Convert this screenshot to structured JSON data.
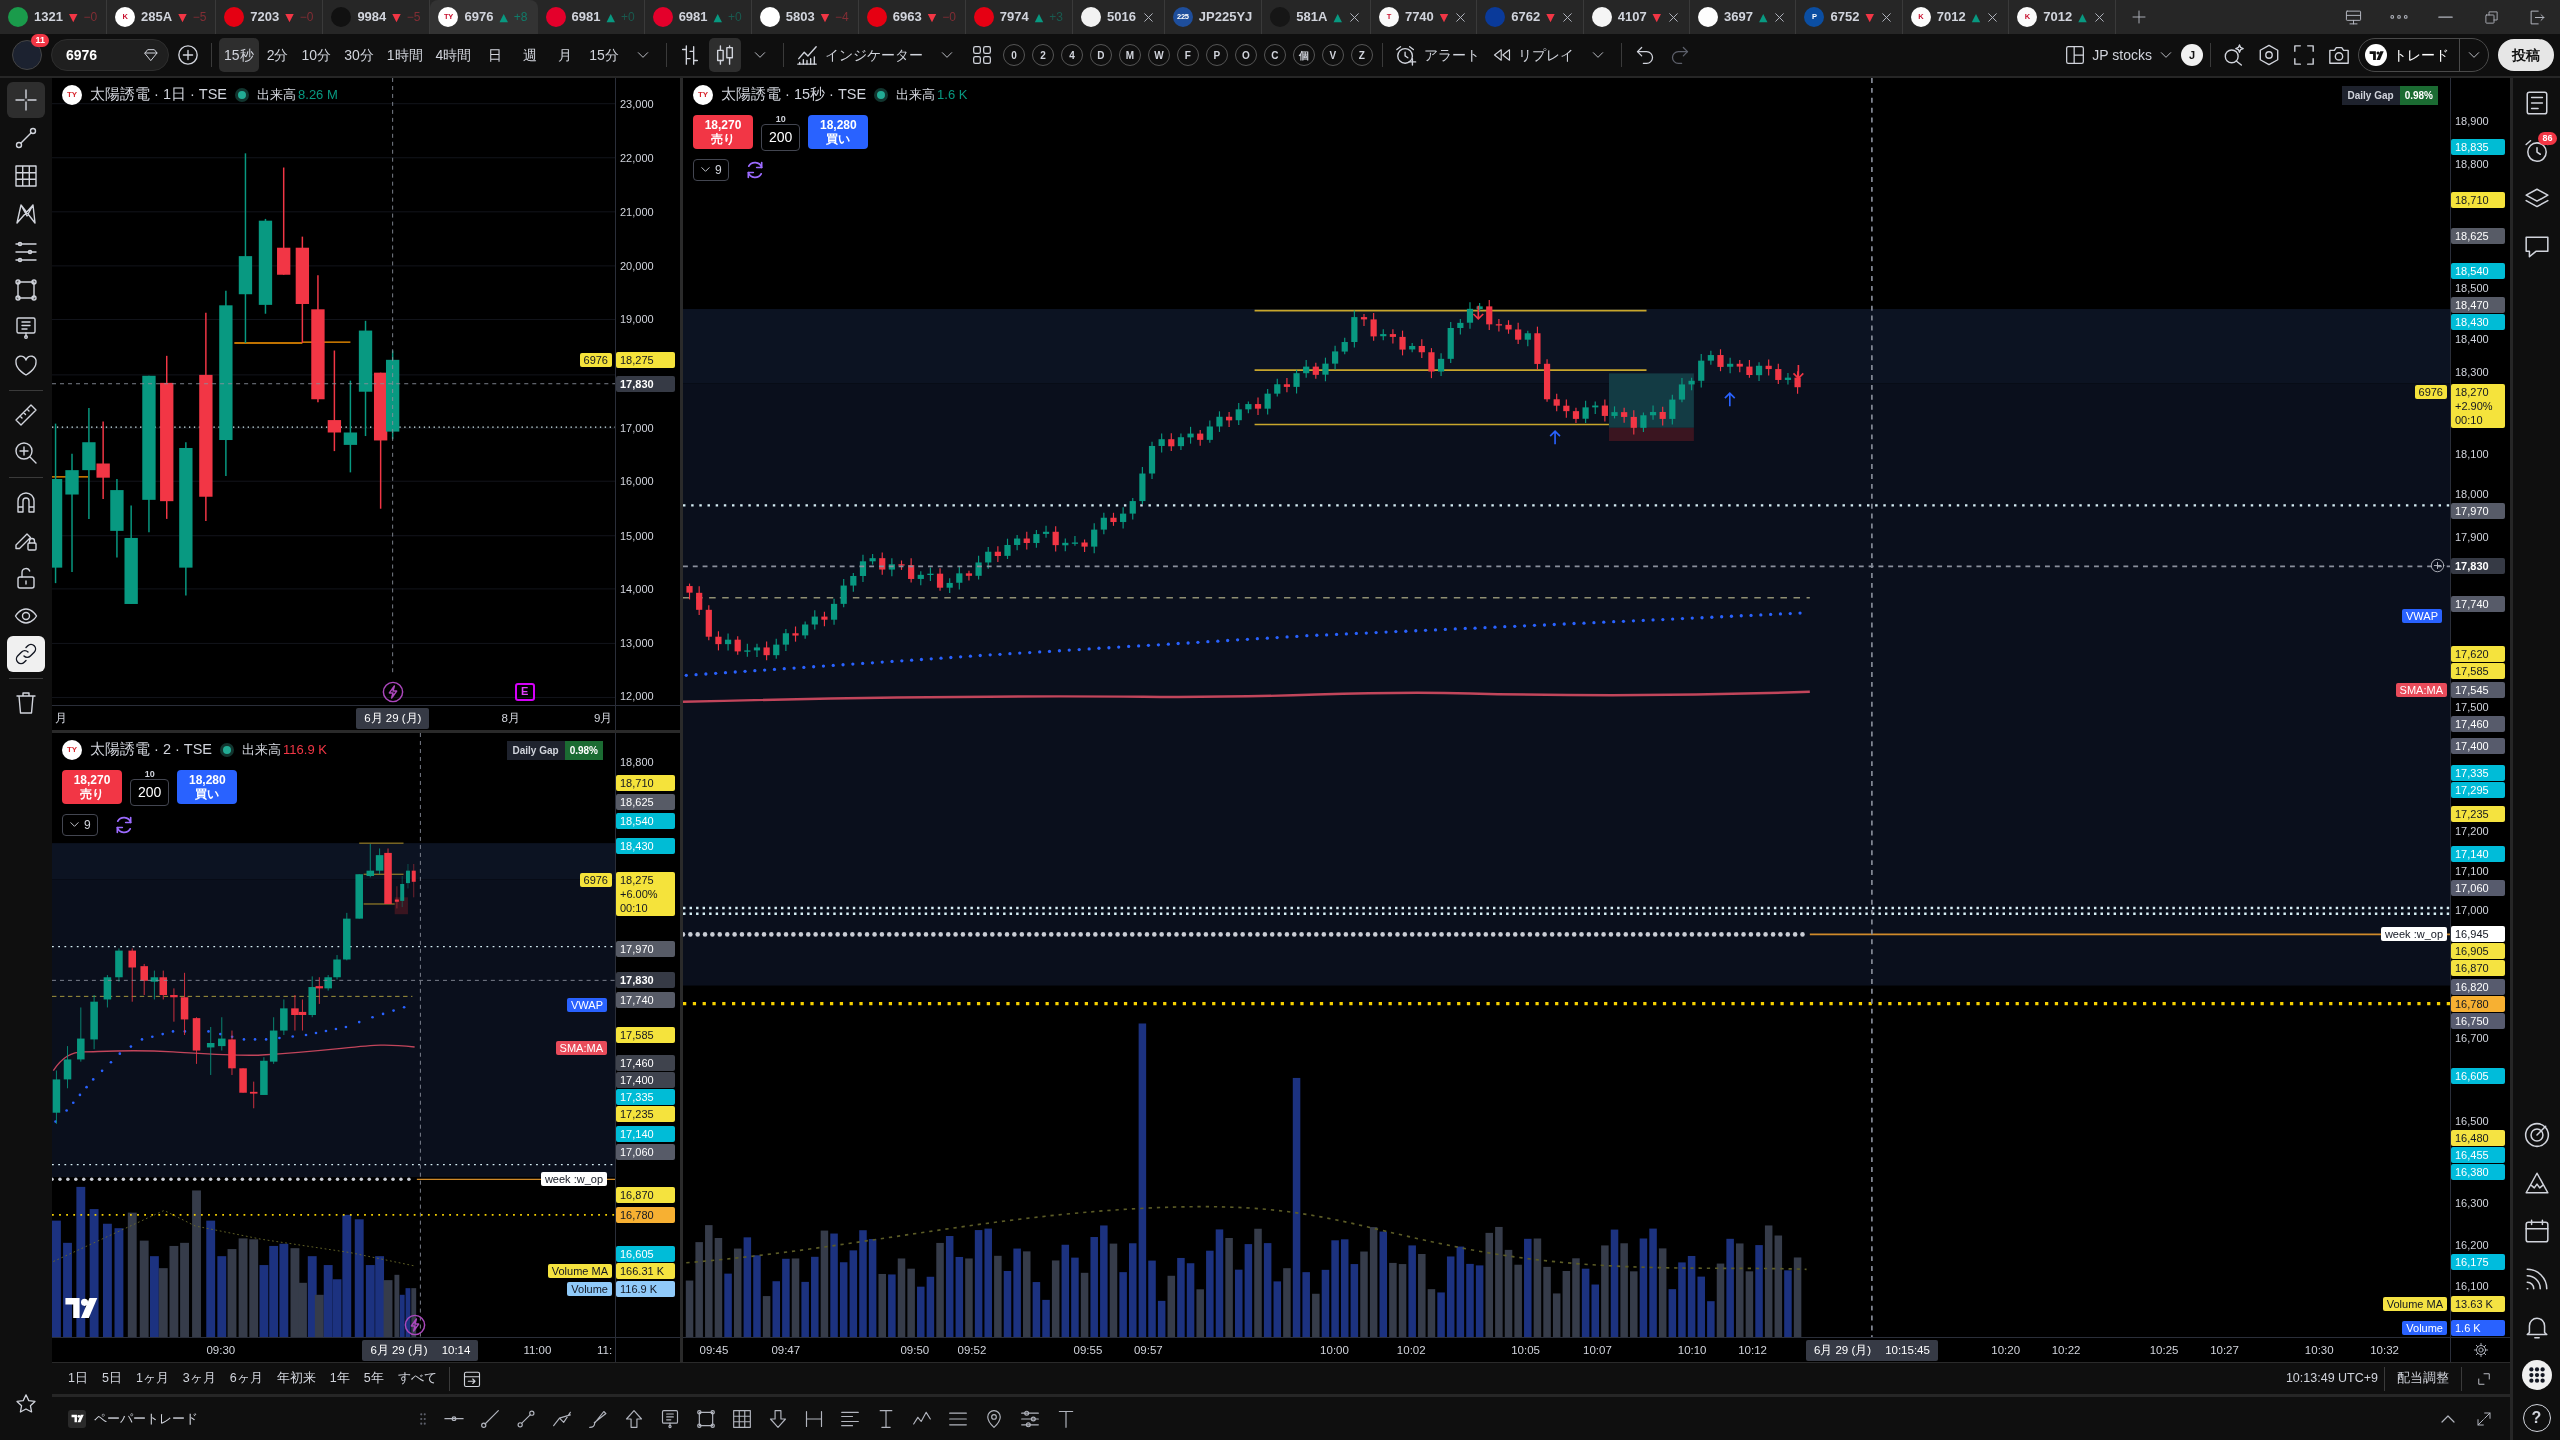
{
  "tabs": [
    {
      "symbol": "1321",
      "trend": {
        "arrow": "▼",
        "color": "#f23645"
      },
      "change": "−0",
      "close_button": false,
      "selected": false,
      "color": "#1a9b4b"
    },
    {
      "symbol": "285A",
      "logo": "K",
      "trend": {
        "arrow": "▼",
        "color": "#f23645"
      },
      "change": "−5",
      "close_button": false,
      "selected": false,
      "color": "#ffffff"
    },
    {
      "symbol": "7203",
      "trend": {
        "arrow": "▼",
        "color": "#f23645"
      },
      "change": "−0",
      "close_button": false,
      "selected": false,
      "color": "#e50012"
    },
    {
      "symbol": "9984",
      "trend": {
        "arrow": "▼",
        "color": "#f23645"
      },
      "change": "−5",
      "close_button": false,
      "selected": false,
      "color": "#111111"
    },
    {
      "symbol": "6976",
      "logo": "TY",
      "trend": {
        "arrow": "▲",
        "color": "#089981"
      },
      "change": "+8",
      "close_button": false,
      "selected": true,
      "color": "#ffffff"
    },
    {
      "symbol": "6981",
      "trend": {
        "arrow": "▲",
        "color": "#089981"
      },
      "change": "+0",
      "close_button": false,
      "selected": false,
      "color": "#e4002b"
    },
    {
      "symbol": "6981",
      "trend": {
        "arrow": "▲",
        "color": "#089981"
      },
      "change": "+0",
      "close_button": false,
      "selected": false,
      "color": "#e4002b"
    },
    {
      "symbol": "5803",
      "trend": {
        "arrow": "▼",
        "color": "#f23645"
      },
      "change": "−4",
      "close_button": false,
      "selected": false,
      "color": "#ffffff"
    },
    {
      "symbol": "6963",
      "trend": {
        "arrow": "▼",
        "color": "#f23645"
      },
      "change": "−0",
      "close_button": false,
      "selected": false,
      "color": "#e60012"
    },
    {
      "symbol": "7974",
      "trend": {
        "arrow": "▲",
        "color": "#089981"
      },
      "change": "+3",
      "close_button": false,
      "selected": false,
      "color": "#e60013"
    },
    {
      "symbol": "5016",
      "close_button": true,
      "selected": false,
      "color": "#f2f2f2"
    },
    {
      "symbol": "JP225YJ",
      "logo": "225",
      "close_button": false,
      "selected": false,
      "color": "#1e4e9c"
    },
    {
      "symbol": "581A",
      "trend": {
        "arrow": "▲",
        "color": "#089981"
      },
      "close_button": true,
      "selected": false,
      "color": "#161616"
    },
    {
      "symbol": "7740",
      "logo": "T",
      "trend": {
        "arrow": "▼",
        "color": "#f23645"
      },
      "close_button": true,
      "selected": false,
      "color": "#fafafa"
    },
    {
      "symbol": "6762",
      "trend": {
        "arrow": "▼",
        "color": "#f23645"
      },
      "close_button": true,
      "selected": false,
      "color": "#0a3a9a"
    },
    {
      "symbol": "4107",
      "trend": {
        "arrow": "▼",
        "color": "#f23645"
      },
      "close_button": true,
      "selected": false,
      "color": "#f5f5f5"
    },
    {
      "symbol": "3697",
      "trend": {
        "arrow": "▲",
        "color": "#089981"
      },
      "close_button": true,
      "selected": false,
      "color": "#fdfdfd"
    },
    {
      "symbol": "6752",
      "logo": "P",
      "trend": {
        "arrow": "▼",
        "color": "#f23645"
      },
      "close_button": true,
      "selected": false,
      "color": "#0b4ea2"
    },
    {
      "symbol": "7012",
      "logo": "K",
      "trend": {
        "arrow": "▲",
        "color": "#089981"
      },
      "close_button": true,
      "selected": false,
      "color": "#fcfcfc"
    },
    {
      "symbol": "7012",
      "logo": "K",
      "trend": {
        "arrow": "▲",
        "color": "#089981"
      },
      "close_button": true,
      "selected": false,
      "color": "#fbfbfb"
    }
  ],
  "toolbar": {
    "avatar_badge": "11",
    "symbol": "6976",
    "intervals": [
      {
        "label": "15秒",
        "selected": true
      },
      {
        "label": "2分",
        "selected": false
      },
      {
        "label": "10分",
        "selected": false
      },
      {
        "label": "30分",
        "selected": false
      },
      {
        "label": "1時間",
        "selected": false
      },
      {
        "label": "4時間",
        "selected": false
      },
      {
        "label": "日",
        "selected": false
      },
      {
        "label": "週",
        "selected": false
      },
      {
        "label": "月",
        "selected": false
      },
      {
        "label": "15分",
        "selected": false
      }
    ],
    "chart_styles": [
      {
        "kind": "bars",
        "selected": false
      },
      {
        "kind": "candles",
        "selected": true
      }
    ],
    "indicators_button": "インジケーター",
    "quick_buttons": [
      "0",
      "2",
      "4",
      "D",
      "M",
      "W",
      "F",
      "P",
      "O",
      "C",
      "個",
      "V",
      "Z"
    ],
    "alert_button": "アラート",
    "replay_button": "リプレイ",
    "layout_name": "JP stocks",
    "user_initial": "J",
    "trade_button": "トレード",
    "publish_button": "投稿"
  },
  "drawing_tools": [
    {
      "kind": "crosshair",
      "selected": true,
      "toggled": false
    },
    {
      "kind": "trend_line",
      "selected": false,
      "toggled": false
    },
    {
      "kind": "fib_grid",
      "selected": false,
      "toggled": false
    },
    {
      "kind": "pattern",
      "selected": false,
      "toggled": false
    },
    {
      "kind": "text_lines",
      "selected": false,
      "toggled": false
    },
    {
      "kind": "rectangle",
      "selected": false,
      "toggled": false
    },
    {
      "kind": "price_note",
      "selected": false,
      "toggled": false
    },
    {
      "kind": "heart",
      "selected": false,
      "toggled": false
    },
    {
      "kind": "ruler",
      "selected": false,
      "toggled": false,
      "divider_before": true
    },
    {
      "kind": "zoom",
      "selected": false,
      "toggled": false
    },
    {
      "kind": "magnet",
      "selected": false,
      "toggled": false,
      "divider_before": true
    },
    {
      "kind": "draw_lock",
      "selected": false,
      "toggled": false
    },
    {
      "kind": "lock",
      "selected": false,
      "toggled": false
    },
    {
      "kind": "eye",
      "selected": false,
      "toggled": false
    },
    {
      "kind": "link",
      "selected": false,
      "toggled": true
    },
    {
      "kind": "trash",
      "selected": false,
      "toggled": false,
      "divider_before": true
    }
  ],
  "panes": [
    {
      "kind": "daily",
      "logo": "TY",
      "title": "太陽誘電 · 1日 · TSE",
      "market_open": true,
      "volume_label": "出来高",
      "volume": {
        "text": "8.26 M",
        "color": "#089981"
      },
      "provider_logo": false,
      "axis_settings": false,
      "price_axis": [
        {
          "text": "23,000"
        },
        {
          "text": "22,000"
        },
        {
          "text": "21,000"
        },
        {
          "text": "20,000"
        },
        {
          "text": "19,000"
        },
        {
          "text": "18,275",
          "color": "#f5e33b",
          "tag": {
            "text": "6976",
            "color": "#f5e33b"
          }
        },
        {
          "kind": "crosshair",
          "text": "17,830",
          "color": "#363a45",
          "add_button": false
        },
        {
          "text": "17,000"
        },
        {
          "text": "16,000"
        },
        {
          "text": "15,000"
        },
        {
          "text": "14,000"
        },
        {
          "text": "13,000"
        },
        {
          "text": "12,000"
        }
      ],
      "time_axis": [
        {
          "text": "月"
        },
        {
          "kind": "crosshair",
          "texts": [
            "6月 29 (月)"
          ]
        },
        {
          "text": "8月"
        },
        {
          "text": "9月"
        }
      ],
      "events": [
        {
          "kind": "split"
        },
        {
          "kind": "earnings",
          "label": "E"
        }
      ]
    },
    {
      "kind": "intraday",
      "logo": "TY",
      "title": "太陽誘電 · 2 · TSE",
      "market_open": true,
      "volume_label": "出来高",
      "volume": {
        "text": "116.9 K",
        "color": "#f23645"
      },
      "daily_gap": {
        "label": "Daily Gap",
        "value": "0.98%"
      },
      "trade": {
        "sell_price": "18,270",
        "sell_label": "売り",
        "step": "10",
        "quantity": "200",
        "buy_price": "18,280",
        "buy_label": "買い"
      },
      "indicators_toggle": "9",
      "provider_logo": true,
      "axis_settings": false,
      "price_axis": [
        {
          "text": "18,800"
        },
        {
          "text": "18,710",
          "color": "#f5e33b"
        },
        {
          "text": "18,625",
          "color": "#575b66"
        },
        {
          "text": "18,540",
          "color": "#00bcd4"
        },
        {
          "text": "18,430",
          "color": "#00bcd5"
        },
        {
          "lines": [
            "18,275",
            "+6.00%",
            "00:10"
          ],
          "color": "#f5e33b",
          "tag": {
            "text": "6976",
            "color": "#f5e33b"
          }
        },
        {
          "text": "17,970",
          "color": "#575b66"
        },
        {
          "kind": "crosshair",
          "text": "17,830",
          "color": "#363a45",
          "add_button": false
        },
        {
          "text": "17,740",
          "color": "#575b67"
        },
        {
          "tag": {
            "text": "VWAP",
            "color": "#2962ff"
          }
        },
        {
          "text": "17,585",
          "color": "#f5e33c"
        },
        {
          "tag": {
            "text": "SMA:MA",
            "color": "#e84b5a"
          }
        },
        {
          "text": "17,460",
          "color": "#3f434d"
        },
        {
          "text": "17,400",
          "color": "#3f434e"
        },
        {
          "text": "17,335",
          "color": "#00bcd6"
        },
        {
          "text": "17,235",
          "color": "#f5e33d"
        },
        {
          "text": "17,140",
          "color": "#00bcd7"
        },
        {
          "text": "17,060",
          "color": "#575b68"
        },
        {
          "tag": {
            "text": "week :w_op",
            "color": "#ffffff"
          }
        },
        {
          "text": "16,870",
          "color": "#f5e33e"
        },
        {
          "text": "16,780",
          "color": "#f7b032"
        },
        {
          "text": "16,605",
          "color": "#00bcd8"
        },
        {
          "text": "166.31 K",
          "color": "#f5e33f",
          "tag": {
            "text": "Volume MA",
            "color": "#f5e33f"
          }
        },
        {
          "text": "116.9 K",
          "color": "#90caf9",
          "tag": {
            "text": "Volume",
            "color": "#90caf9"
          }
        }
      ],
      "time_axis": [
        {
          "text": "09:30"
        },
        {
          "kind": "crosshair",
          "texts": [
            "6月 29 (月)",
            "10:14"
          ]
        },
        {
          "text": "11:00"
        },
        {
          "text": "11:"
        }
      ],
      "events": [
        {
          "kind": "split"
        }
      ]
    },
    {
      "kind": "tick",
      "logo": "TY",
      "title": "太陽誘電 · 15秒 · TSE",
      "market_open": true,
      "volume_label": "出来高",
      "volume": {
        "text": "1.6 K",
        "color": "#089981"
      },
      "daily_gap": {
        "label": "Daily Gap",
        "value": "0.98%"
      },
      "trade": {
        "sell_price": "18,270",
        "sell_label": "売り",
        "step": "10",
        "quantity": "200",
        "buy_price": "18,280",
        "buy_label": "買い"
      },
      "indicators_toggle": "9",
      "provider_logo": false,
      "axis_settings": true,
      "price_axis": [
        {
          "text": "18,900"
        },
        {
          "text": "18,835",
          "color": "#00bcd4"
        },
        {
          "text": "18,800"
        },
        {
          "text": "18,710",
          "color": "#f5e33b"
        },
        {
          "text": "18,625",
          "color": "#575b66"
        },
        {
          "text": "18,540",
          "color": "#00bcd5"
        },
        {
          "text": "18,500"
        },
        {
          "text": "18,470",
          "color": "#575b67"
        },
        {
          "text": "18,430",
          "color": "#00bcd6"
        },
        {
          "text": "18,400"
        },
        {
          "text": "18,300"
        },
        {
          "lines": [
            "18,270",
            "+2.90%",
            "00:10"
          ],
          "color": "#f5e33c",
          "tag": {
            "text": "6976",
            "color": "#f5e33c"
          }
        },
        {
          "text": "18,100"
        },
        {
          "text": "18,000"
        },
        {
          "text": "17,970",
          "color": "#575b68"
        },
        {
          "text": "17,900"
        },
        {
          "kind": "crosshair",
          "text": "17,830",
          "color": "#363a45",
          "add_button": true
        },
        {
          "text": "17,740",
          "color": "#575b69"
        },
        {
          "tag": {
            "text": "VWAP",
            "color": "#2962ff"
          }
        },
        {
          "text": "17,620",
          "color": "#f5e33d"
        },
        {
          "text": "17,585",
          "color": "#f5e33e"
        },
        {
          "text": "17,545",
          "color": "#575b6a",
          "tag": {
            "text": "SMA:MA",
            "color": "#e84b5a"
          }
        },
        {
          "text": "17,500"
        },
        {
          "text": "17,460",
          "color": "#575b6b"
        },
        {
          "text": "17,400",
          "color": "#575b6c"
        },
        {
          "text": "17,335",
          "color": "#00bcd7"
        },
        {
          "text": "17,295",
          "color": "#00bcd8"
        },
        {
          "text": "17,235",
          "color": "#f5e33f"
        },
        {
          "text": "17,200"
        },
        {
          "text": "17,140",
          "color": "#00bcd9"
        },
        {
          "text": "17,100"
        },
        {
          "text": "17,060",
          "color": "#575b6d"
        },
        {
          "text": "17,000"
        },
        {
          "text": "16,945",
          "color": "#ffffff",
          "tag": {
            "text": "week :w_op",
            "color": "#ffffff"
          }
        },
        {
          "text": "16,905",
          "color": "#f5e340"
        },
        {
          "text": "16,870",
          "color": "#f5e341"
        },
        {
          "text": "16,820",
          "color": "#575b6e"
        },
        {
          "text": "16,780",
          "color": "#f7b032"
        },
        {
          "text": "16,750",
          "color": "#575b6f"
        },
        {
          "text": "16,700"
        },
        {
          "text": "16,605",
          "color": "#00bcda"
        },
        {
          "text": "16,500"
        },
        {
          "text": "16,480",
          "color": "#f5e342"
        },
        {
          "text": "16,455",
          "color": "#00bcdb"
        },
        {
          "text": "16,380",
          "color": "#00bcdc"
        },
        {
          "text": "16,300"
        },
        {
          "text": "16,200"
        },
        {
          "text": "16,175",
          "color": "#00bcdd"
        },
        {
          "text": "16,100"
        },
        {
          "text": "13.63 K",
          "color": "#f5e343",
          "tag": {
            "text": "Volume MA",
            "color": "#f5e343"
          }
        },
        {
          "text": "1.6 K",
          "color": "#2962ff",
          "tag": {
            "text": "Volume",
            "color": "#2962fe"
          }
        }
      ],
      "time_axis": [
        {
          "text": "09:45"
        },
        {
          "text": "09:47"
        },
        {
          "text": "09:50"
        },
        {
          "text": "09:52"
        },
        {
          "text": "09:55"
        },
        {
          "text": "09:57"
        },
        {
          "text": "10:00"
        },
        {
          "text": "10:02"
        },
        {
          "text": "10:05"
        },
        {
          "text": "10:07"
        },
        {
          "text": "10:10"
        },
        {
          "text": "10:12"
        },
        {
          "kind": "crosshair",
          "texts": [
            "6月 29 (月)",
            "10:15:45"
          ]
        },
        {
          "text": "10:20"
        },
        {
          "text": "10:22"
        },
        {
          "text": "10:25"
        },
        {
          "text": "10:27"
        },
        {
          "text": "10:30"
        },
        {
          "text": "10:32"
        }
      ]
    }
  ],
  "range_bar": {
    "ranges": [
      "1日",
      "5日",
      "1ヶ月",
      "3ヶ月",
      "6ヶ月",
      "年初来",
      "1年",
      "5年",
      "すべて"
    ],
    "clock": "10:13:49 UTC+9",
    "adjust_button": "配当調整"
  },
  "bottom_panel": {
    "title": "ペーパートレード"
  },
  "right_sidebar": {
    "alerts_badge": "86",
    "help_label": "?"
  }
}
